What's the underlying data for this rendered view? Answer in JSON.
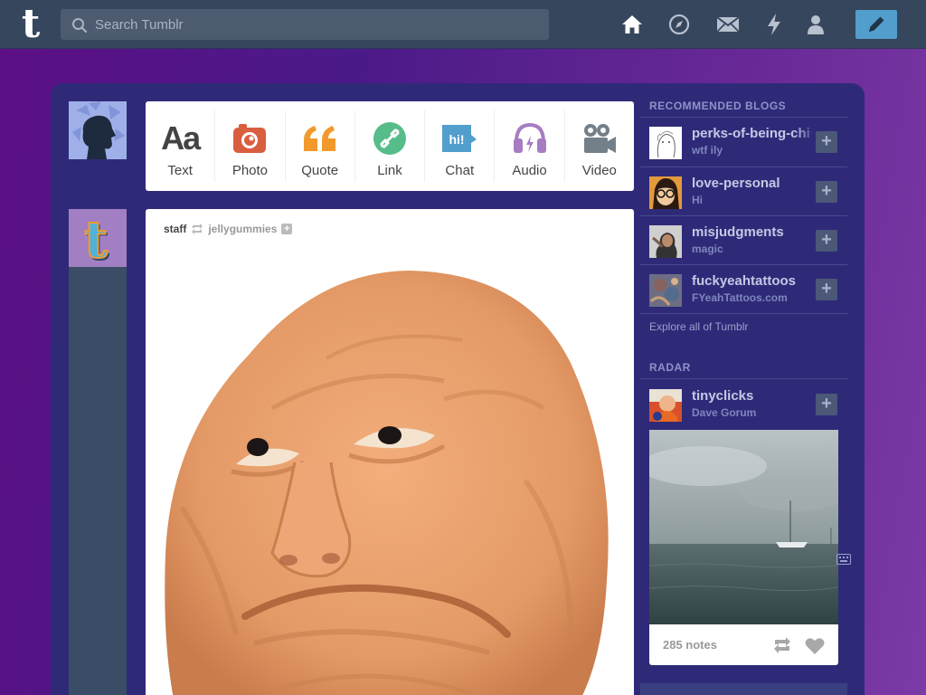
{
  "header": {
    "search_placeholder": "Search Tumblr",
    "nav": [
      "home-icon",
      "explore-icon",
      "inbox-icon",
      "activity-icon",
      "account-icon"
    ],
    "compose_icon": "pencil-icon",
    "colors": {
      "bar": "#36465d",
      "accent": "#529ecc"
    }
  },
  "post_types": [
    {
      "label": "Text",
      "icon": "text-icon",
      "color": "#444444"
    },
    {
      "label": "Photo",
      "icon": "camera-icon",
      "color": "#d95e40"
    },
    {
      "label": "Quote",
      "icon": "quote-icon",
      "color": "#f2992e"
    },
    {
      "label": "Link",
      "icon": "link-icon",
      "color": "#56bc8a"
    },
    {
      "label": "Chat",
      "icon": "chat-icon",
      "color": "#529ecc"
    },
    {
      "label": "Audio",
      "icon": "headphones-icon",
      "color": "#a77dc2"
    },
    {
      "label": "Video",
      "icon": "video-camera-icon",
      "color": "#748089"
    }
  ],
  "post": {
    "author": "staff",
    "reblogged_from": "jellygummies"
  },
  "sidebar": {
    "recommended_title": "RECOMMENDED BLOGS",
    "blogs": [
      {
        "name": "perks-of-being-chir",
        "subtitle": "wtf ily"
      },
      {
        "name": "love-personal",
        "subtitle": "Hi"
      },
      {
        "name": "misjudgments",
        "subtitle": "magic"
      },
      {
        "name": "fuckyeahtattoos",
        "subtitle": "FYeahTattoos.com"
      }
    ],
    "explore_link": "Explore all of Tumblr",
    "radar_title": "RADAR",
    "radar": {
      "name": "tinyclicks",
      "subtitle": "Dave Gorum",
      "notes": "285 notes"
    }
  }
}
